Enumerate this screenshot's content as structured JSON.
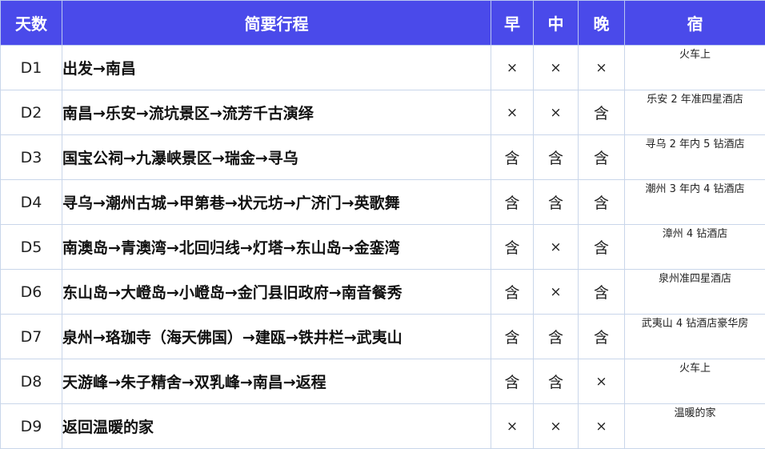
{
  "headers": {
    "day": "天数",
    "route": "简要行程",
    "breakfast": "早",
    "lunch": "中",
    "dinner": "晚",
    "stay": "宿"
  },
  "colors": {
    "header_bg": "#4a4aea",
    "header_text": "#ffffff",
    "border": "#c9d6ea"
  },
  "rows": [
    {
      "day": "D1",
      "route": "出发→南昌",
      "breakfast": "×",
      "lunch": "×",
      "dinner": "×",
      "stay": "火车上"
    },
    {
      "day": "D2",
      "route": "南昌→乐安→流坑景区→流芳千古演绎",
      "breakfast": "×",
      "lunch": "×",
      "dinner": "含",
      "stay": "乐安 2 年准四星酒店"
    },
    {
      "day": "D3",
      "route": "国宝公祠→九瀑峡景区→瑞金→寻乌",
      "breakfast": "含",
      "lunch": "含",
      "dinner": "含",
      "stay": "寻乌 2 年内 5 钻酒店"
    },
    {
      "day": "D4",
      "route": "寻乌→潮州古城→甲第巷→状元坊→广济门→英歌舞",
      "breakfast": "含",
      "lunch": "含",
      "dinner": "含",
      "stay": "潮州 3 年内 4 钻酒店"
    },
    {
      "day": "D5",
      "route": "南澳岛→青澳湾→北回归线→灯塔→东山岛→金銮湾",
      "breakfast": "含",
      "lunch": "×",
      "dinner": "含",
      "stay": "漳州 4 钻酒店"
    },
    {
      "day": "D6",
      "route": "东山岛→大嶝岛→小嶝岛→金门县旧政府→南音餐秀",
      "breakfast": "含",
      "lunch": "×",
      "dinner": "含",
      "stay": "泉州准四星酒店"
    },
    {
      "day": "D7",
      "route": "泉州→珞珈寺（海天佛国）→建瓯→铁井栏→武夷山",
      "breakfast": "含",
      "lunch": "含",
      "dinner": "含",
      "stay": "武夷山 4 钻酒店豪华房"
    },
    {
      "day": "D8",
      "route": "天游峰→朱子精舍→双乳峰→南昌→返程",
      "breakfast": "含",
      "lunch": "含",
      "dinner": "×",
      "stay": "火车上"
    },
    {
      "day": "D9",
      "route": "返回温暖的家",
      "breakfast": "×",
      "lunch": "×",
      "dinner": "×",
      "stay": "温暖的家"
    }
  ]
}
